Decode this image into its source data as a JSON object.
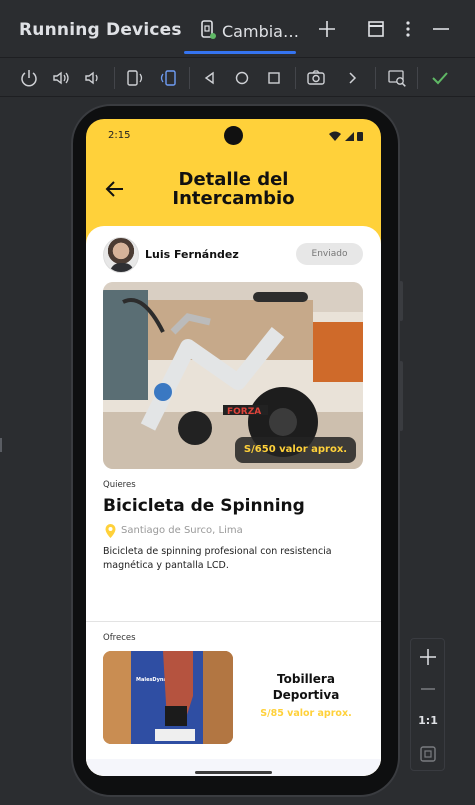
{
  "ide": {
    "panel_title": "Running Devices",
    "tab_label": "Cambia…",
    "accent": "#3574f0",
    "icons": [
      "device-tab-icon",
      "add-icon",
      "maximize-icon",
      "more-options-icon",
      "minimize-icon"
    ]
  },
  "toolbar": {
    "icons": [
      "power-icon",
      "volume-up-icon",
      "volume-down-icon",
      "rotate-left-icon",
      "rotate-right-icon",
      "fold-icon",
      "back-icon",
      "home-icon",
      "overview-icon",
      "screenshot-icon",
      "chevron-right-icon",
      "inspect-icon",
      "check-icon"
    ]
  },
  "zoom": {
    "one_to_one": "1:1",
    "icons": [
      "zoom-in-icon",
      "zoom-out-icon",
      "fit-screen-icon"
    ]
  },
  "device": {
    "status_time": "2:15",
    "brand_color": "#ffd13a"
  },
  "app": {
    "header_title_line1": "Detalle del",
    "header_title_line2": "Intercambio",
    "owner_name": "Luis Fernández",
    "status_badge": "Enviado",
    "want_label": "Quieres",
    "want_item": {
      "title": "Bicicleta de Spinning",
      "price": "S/650 valor aprox.",
      "location": "Santiago de Surco, Lima",
      "description": "Bicicleta de spinning profesional con resistencia magnética y pantalla LCD.",
      "photo_brand": "FORZA"
    },
    "offer_label": "Ofreces",
    "offer_item": {
      "title_line1": "Tobillera",
      "title_line2": "Deportiva",
      "price": "S/85 valor aprox.",
      "photo_brand": "MalesDynamic"
    }
  }
}
